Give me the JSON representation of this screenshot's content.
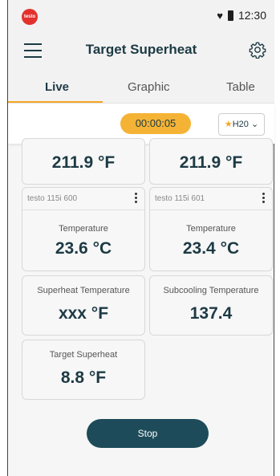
{
  "status_bar": {
    "time": "12:30",
    "logo_text": "testo"
  },
  "app_bar": {
    "title": "Target Superheat"
  },
  "tabs": [
    {
      "label": "Live"
    },
    {
      "label": "Graphic"
    },
    {
      "label": "Table"
    }
  ],
  "timer": "00:00:05",
  "refrigerant": {
    "label": "H20"
  },
  "cards": {
    "top_left": {
      "value": "211.9 °F"
    },
    "top_right": {
      "value": "211.9 °F"
    },
    "probe_left": {
      "probe": "testo 115i   600",
      "label": "Temperature",
      "value": "23.6 °C"
    },
    "probe_right": {
      "probe": "testo 115i   601",
      "label": "Temperature",
      "value": "23.4 °C"
    },
    "superheat": {
      "label": "Superheat Temperature",
      "value": "xxx °F"
    },
    "subcooling": {
      "label": "Subcooling Temperature",
      "value": "137.4"
    },
    "target": {
      "label": "Target Superheat",
      "value": "8.8 °F"
    }
  },
  "stop_button": {
    "label": "Stop"
  }
}
